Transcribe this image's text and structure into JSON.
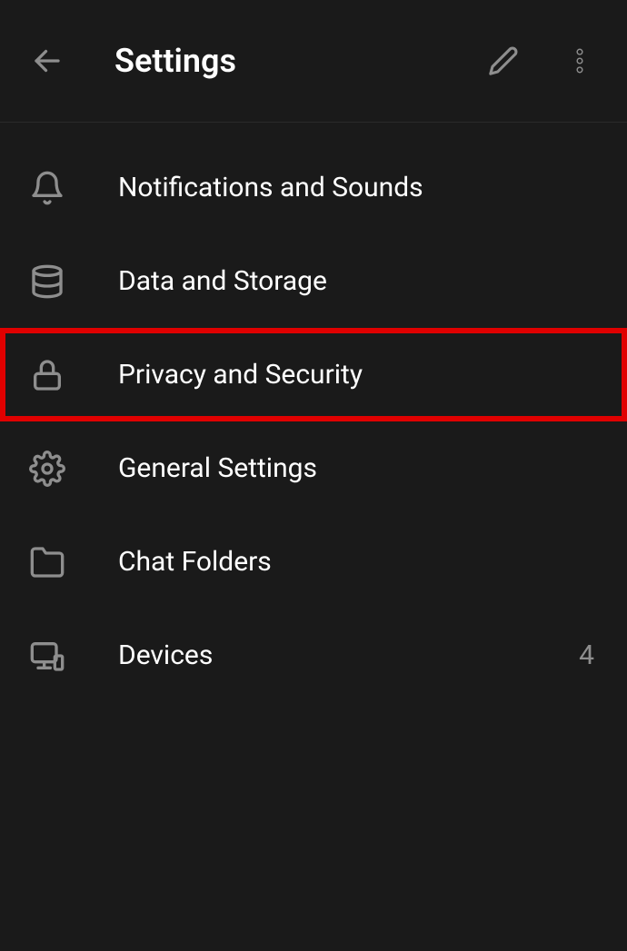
{
  "header": {
    "title": "Settings"
  },
  "items": [
    {
      "label": "Notifications and Sounds",
      "icon": "bell",
      "highlighted": false
    },
    {
      "label": "Data and Storage",
      "icon": "database",
      "highlighted": false
    },
    {
      "label": "Privacy and Security",
      "icon": "lock",
      "highlighted": true
    },
    {
      "label": "General Settings",
      "icon": "gear",
      "highlighted": false
    },
    {
      "label": "Chat Folders",
      "icon": "folder",
      "highlighted": false
    },
    {
      "label": "Devices",
      "icon": "devices",
      "highlighted": false,
      "value": "4"
    }
  ]
}
